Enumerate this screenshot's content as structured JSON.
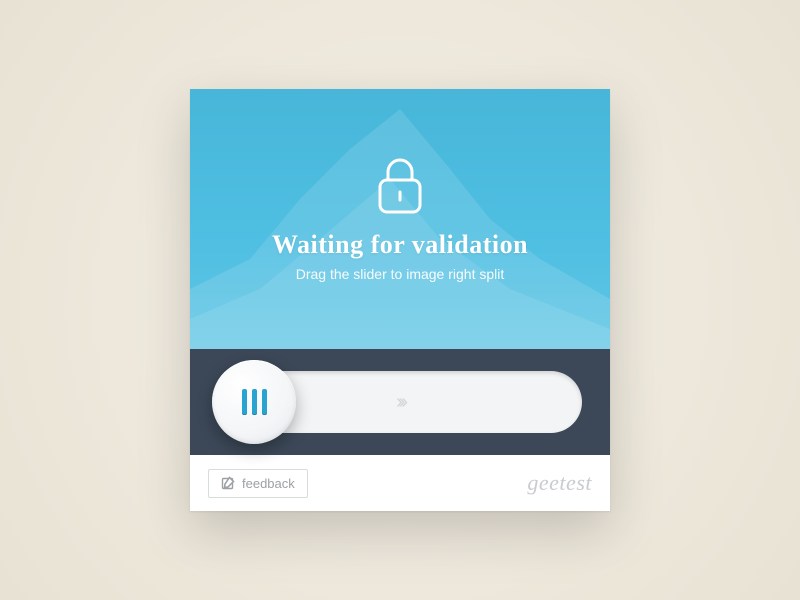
{
  "prompt": {
    "title": "Waiting for validation",
    "subtitle": "Drag the slider to image right split"
  },
  "footer": {
    "feedback_label": "feedback",
    "brand": "geetest"
  }
}
